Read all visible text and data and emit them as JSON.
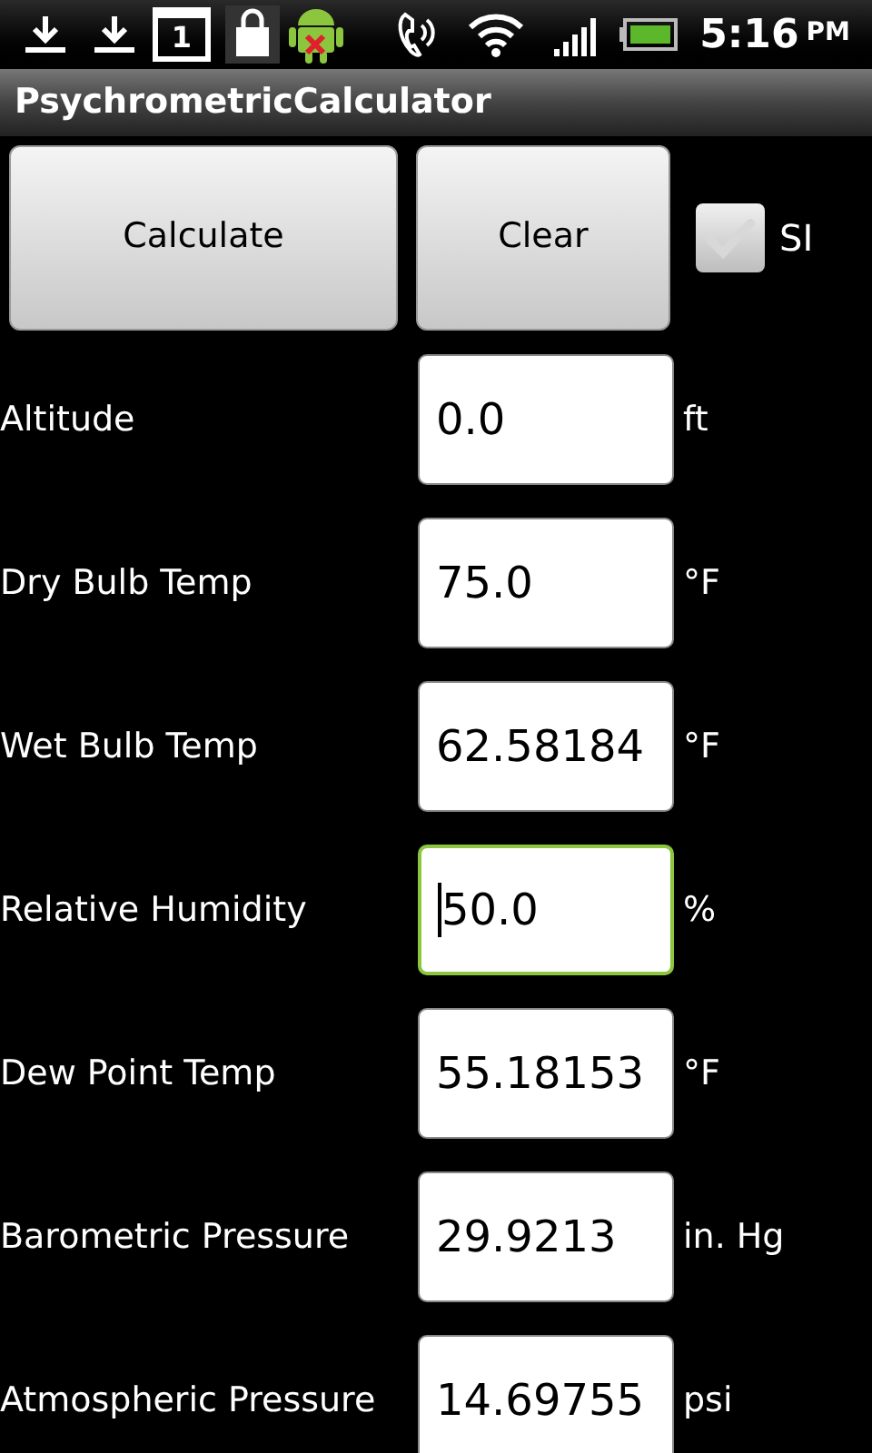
{
  "status_bar": {
    "time": "5:16",
    "ampm": "PM",
    "calendar_day": "1"
  },
  "title": "PsychrometricCalculator",
  "buttons": [
    "Calculate",
    "Clear"
  ],
  "si": {
    "label": "SI",
    "checked": false
  },
  "fields": [
    {
      "label": "Altitude",
      "value": "0.0",
      "unit": "ft",
      "focused": false
    },
    {
      "label": "Dry Bulb Temp",
      "value": "75.0",
      "unit": "°F",
      "focused": false
    },
    {
      "label": "Wet Bulb Temp",
      "value": "62.58184",
      "unit": "°F",
      "focused": false
    },
    {
      "label": "Relative Humidity",
      "value": "50.0",
      "unit": "%",
      "focused": true
    },
    {
      "label": "Dew Point Temp",
      "value": "55.18153",
      "unit": "°F",
      "focused": false
    },
    {
      "label": "Barometric Pressure",
      "value": "29.9213",
      "unit": "in. Hg",
      "focused": false
    },
    {
      "label": "Atmospheric Pressure",
      "value": "14.69755",
      "unit": "psi",
      "focused": false
    }
  ]
}
